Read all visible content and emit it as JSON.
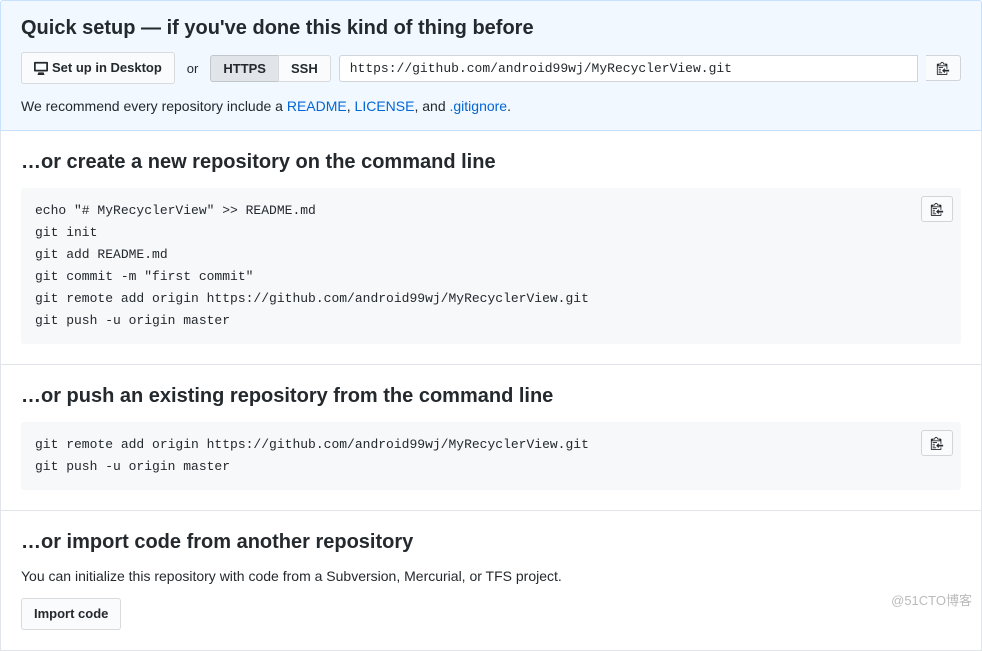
{
  "quickSetup": {
    "heading": "Quick setup — if you've done this kind of thing before",
    "desktopBtn": "Set up in Desktop",
    "orText": "or",
    "httpsTab": "HTTPS",
    "sshTab": "SSH",
    "cloneUrl": "https://github.com/android99wj/MyRecyclerView.git",
    "recommendPrefix": "We recommend every repository include a ",
    "readmeLink": "README",
    "comma1": ", ",
    "licenseLink": "LICENSE",
    "comma2": ", and ",
    "gitignoreLink": ".gitignore",
    "recommendSuffix": "."
  },
  "createSection": {
    "heading": "…or create a new repository on the command line",
    "code": "echo \"# MyRecyclerView\" >> README.md\ngit init\ngit add README.md\ngit commit -m \"first commit\"\ngit remote add origin https://github.com/android99wj/MyRecyclerView.git\ngit push -u origin master"
  },
  "pushSection": {
    "heading": "…or push an existing repository from the command line",
    "code": "git remote add origin https://github.com/android99wj/MyRecyclerView.git\ngit push -u origin master"
  },
  "importSection": {
    "heading": "…or import code from another repository",
    "description": "You can initialize this repository with code from a Subversion, Mercurial, or TFS project.",
    "importBtn": "Import code"
  },
  "watermark": "@51CTO博客"
}
